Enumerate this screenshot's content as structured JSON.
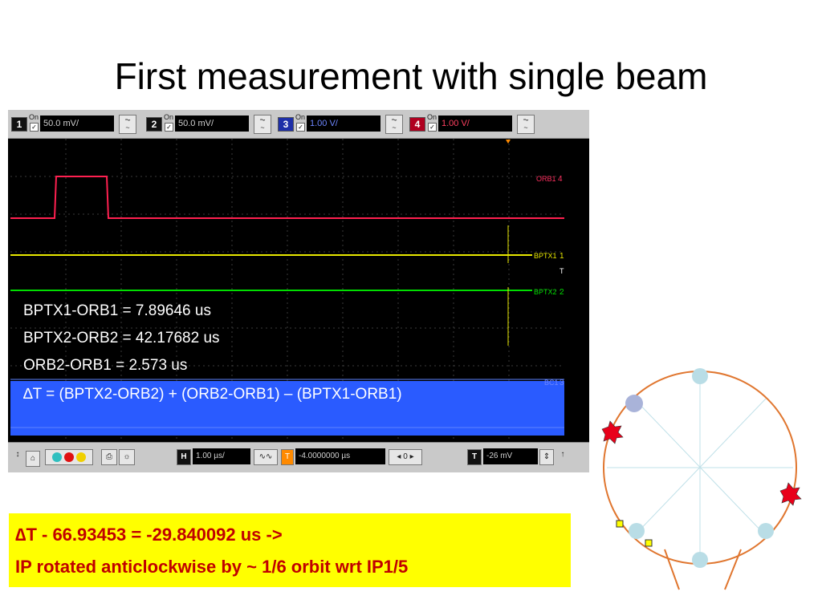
{
  "title": "First measurement with single beam",
  "scope": {
    "channels": [
      {
        "num": "1",
        "on": "On",
        "scale": "50.0 mV/",
        "color": "#ffff00"
      },
      {
        "num": "2",
        "on": "On",
        "scale": "50.0 mV/",
        "color": "#00ff00"
      },
      {
        "num": "3",
        "on": "On",
        "scale": "1.00 V/",
        "color": "#3a6cff"
      },
      {
        "num": "4",
        "on": "On",
        "scale": "1.00 V/",
        "color": "#ff2050"
      }
    ],
    "traces": {
      "orb1": "ORB1",
      "bptx1": "BPTX1",
      "bptx2": "BPTX2",
      "bc1": "BC1",
      "orb1_marker": "4",
      "bptx1_marker": "1",
      "bptx2_marker": "2",
      "bc1_marker": "3",
      "trigger_marker": "T"
    },
    "horizontal": {
      "label": "H",
      "scale": "1.00 µs/",
      "delay": "-4.0000000 µs",
      "step": "0"
    },
    "trigger": {
      "label": "T",
      "level": "-26 mV"
    }
  },
  "measurements": {
    "line1": "BPTX1-ORB1 = 7.89646  us",
    "line2": "BPTX2-ORB2 = 42.17682  us",
    "line3": "ORB2-ORB1 = 2.573 us",
    "line4": "∆T = (BPTX2-ORB2) + (ORB2-ORB1) – (BPTX1-ORB1)"
  },
  "result": {
    "line1": "∆T - 66.93453 = -29.840092 us  ->",
    "line2": "IP rotated anticlockwise by ~ 1/6 orbit wrt IP1/5"
  },
  "colors": {
    "result_bg": "#ffff00",
    "result_text": "#c00000",
    "orbit_ring": "#e0762f",
    "ip_node": "#b9dde6",
    "ip_node_active": "#a9b3d9",
    "collision_star": "#e8001a"
  }
}
